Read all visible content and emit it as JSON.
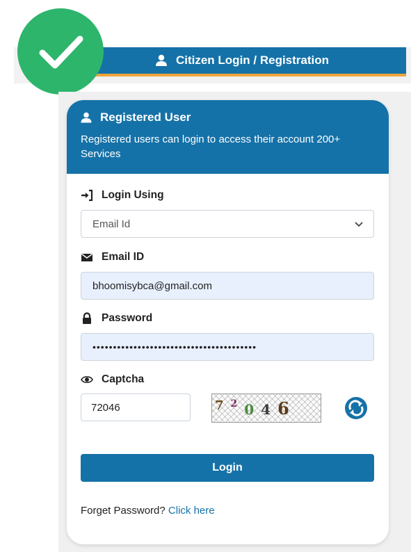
{
  "header": {
    "title": "Citizen Login / Registration"
  },
  "card": {
    "title": "Registered User",
    "description": "Registered users can login to access their account 200+ Services"
  },
  "login_using": {
    "label": "Login Using",
    "selected": "Email Id"
  },
  "email": {
    "label": "Email ID",
    "value": "bhoomisybca@gmail.com"
  },
  "password": {
    "label": "Password",
    "value": "••••••••••••••••••••••••••••••••••••••••"
  },
  "captcha": {
    "label": "Captcha",
    "value": "72046",
    "image_chars": [
      "7",
      "2",
      "0",
      "4",
      "6"
    ],
    "image_colors": [
      "#6b4a1c",
      "#7a2a5e",
      "#4a8a3a",
      "#3a3a3a",
      "#5a3a1a"
    ]
  },
  "login_button": "Login",
  "forget": {
    "text": "Forget Password?",
    "link": "Click here"
  },
  "colors": {
    "primary": "#1572a8",
    "accent": "#f0a43a",
    "success": "#2db56c"
  }
}
